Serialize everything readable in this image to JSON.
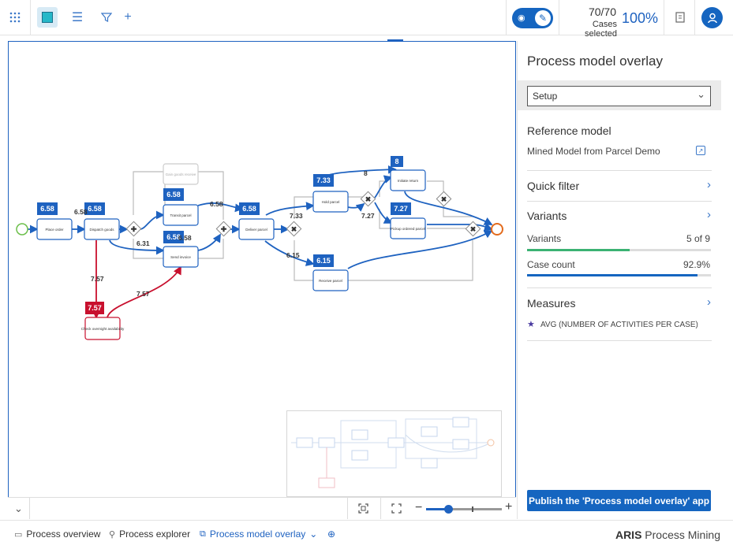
{
  "toolbar": {
    "apps_icon": "grid-icon",
    "edit_icon": "pencil-icon",
    "menu_icon": "hamburger-icon",
    "filter_icon": "filter-icon",
    "add_icon": "plus-icon",
    "cases_count": "70/70",
    "cases_label": "Cases selected",
    "cases_percent": "100%",
    "accent": "#1565c0"
  },
  "panel": {
    "title": "Process model overlay",
    "setup_value": "Setup",
    "reference_title": "Reference model",
    "reference_value": "Mined Model from Parcel Demo",
    "quick_filter": "Quick filter",
    "variants_title": "Variants",
    "variants_label": "Variants",
    "variants_value": "5 of 9",
    "variants_fraction": 0.556,
    "case_count_label": "Case count",
    "case_count_value": "92.9%",
    "case_count_fraction": 0.929,
    "measures_title": "Measures",
    "measure_item": "AVG (NUMBER OF ACTIVITIES PER CASE)",
    "publish_label": "Publish the 'Process model overlay' app"
  },
  "model": {
    "nodes": [
      {
        "label": "Place order"
      },
      {
        "label": "Dispatch goods"
      },
      {
        "label": "Transit parcel"
      },
      {
        "label": "Send invoice"
      },
      {
        "label": "Deliver parcel"
      },
      {
        "label": "Hold parcel"
      },
      {
        "label": "Initiate return"
      },
      {
        "label": "Pickup ordered parcel"
      },
      {
        "label": "Receive parcel"
      },
      {
        "label": "Check overnight availability"
      },
      {
        "label": "Gain goods receive"
      }
    ],
    "badges": [
      "6.58",
      "6.58",
      "6.58",
      "6.58",
      "6.58",
      "7.33",
      "8",
      "7.27",
      "6.15",
      "7.57"
    ],
    "edge_labels": [
      "6.58",
      "6.58",
      "6.31",
      "6.58",
      "7.33",
      "7.27",
      "8",
      "6.15",
      "7.57",
      "7.57"
    ]
  },
  "tabs": [
    {
      "label": "Process overview",
      "icon": "overview-icon"
    },
    {
      "label": "Process explorer",
      "icon": "explorer-icon"
    },
    {
      "label": "Process model overlay",
      "icon": "overlay-icon"
    }
  ],
  "brand": {
    "bold": "ARIS",
    "rest": " Process Mining"
  }
}
